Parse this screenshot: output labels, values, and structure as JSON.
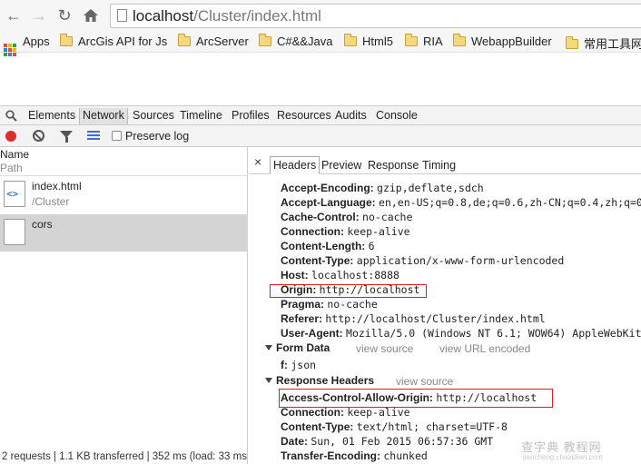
{
  "browser": {
    "url_host": "localhost",
    "url_path": "/Cluster/index.html",
    "bookmarks": [
      "Apps",
      "ArcGis API for Js",
      "ArcServer",
      "C#&&Java",
      "Html5",
      "RIA",
      "WebappBuilder",
      "常用工具网站"
    ]
  },
  "devtools": {
    "tabs": [
      "Elements",
      "Network",
      "Sources",
      "Timeline",
      "Profiles",
      "Resources",
      "Audits",
      "Console"
    ],
    "active_tab": "Network",
    "preserve_log_label": "Preserve log",
    "columns": {
      "name": "Name",
      "path": "Path"
    },
    "requests": [
      {
        "name": "index.html",
        "path": "/Cluster"
      },
      {
        "name": "cors",
        "path": ""
      }
    ],
    "status": "2 requests | 1.1 KB transferred | 352 ms (load: 33 ms...",
    "detail_tabs": [
      "Headers",
      "Preview",
      "Response",
      "Timing"
    ],
    "request_headers": [
      {
        "k": "Accept-Encoding:",
        "v": "gzip,deflate,sdch"
      },
      {
        "k": "Accept-Language:",
        "v": "en,en-US;q=0.8,de;q=0.6,zh-CN;q=0.4,zh;q=0"
      },
      {
        "k": "Cache-Control:",
        "v": "no-cache"
      },
      {
        "k": "Connection:",
        "v": "keep-alive"
      },
      {
        "k": "Content-Length:",
        "v": "6"
      },
      {
        "k": "Content-Type:",
        "v": "application/x-www-form-urlencoded"
      },
      {
        "k": "Host:",
        "v": "localhost:8888"
      },
      {
        "k": "Origin:",
        "v": "http://localhost"
      },
      {
        "k": "Pragma:",
        "v": "no-cache"
      },
      {
        "k": "Referer:",
        "v": "http://localhost/Cluster/index.html"
      },
      {
        "k": "User-Agent:",
        "v": "Mozilla/5.0 (Windows NT 6.1; WOW64) AppleWebKit"
      }
    ],
    "form_data": {
      "title": "Form Data",
      "link1": "view source",
      "link2": "view URL encoded",
      "entry": {
        "k": "f:",
        "v": "json"
      }
    },
    "response": {
      "title": "Response Headers",
      "link": "view source",
      "headers": [
        {
          "k": "Access-Control-Allow-Origin:",
          "v": "http://localhost"
        },
        {
          "k": "Connection:",
          "v": "keep-alive"
        },
        {
          "k": "Content-Type:",
          "v": "text/html; charset=UTF-8"
        },
        {
          "k": "Date:",
          "v": "Sun, 01 Feb 2015 06:57:36 GMT"
        },
        {
          "k": "Transfer-Encoding:",
          "v": "chunked"
        }
      ]
    }
  },
  "watermark": {
    "line1": "查字典 教程网",
    "line2": "jiaocheng.chazidian.com"
  },
  "colors": {
    "highlight": "#e02020",
    "record": "#d9302c",
    "selected_row": "#d4d4d4"
  }
}
